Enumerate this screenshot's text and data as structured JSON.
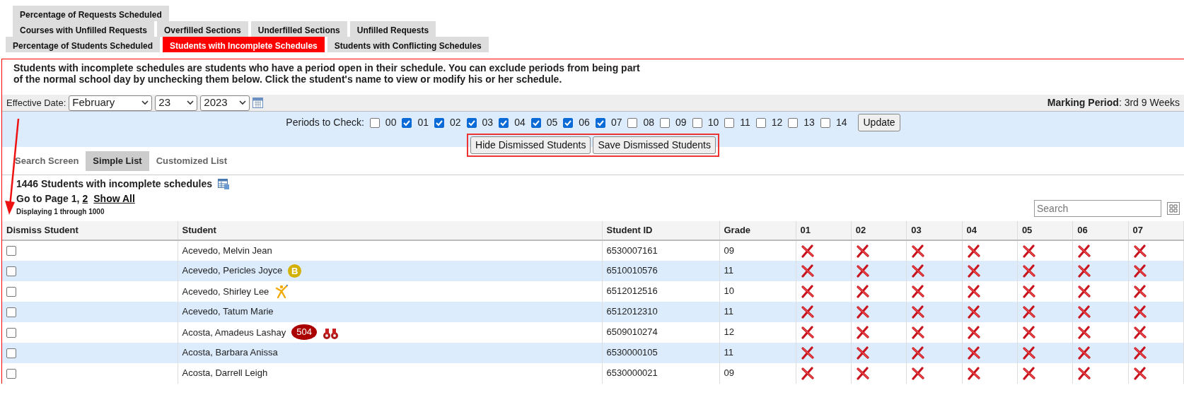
{
  "report_tab_rows": [
    [
      {
        "label": "Percentage of Requests Scheduled",
        "selected": false
      }
    ],
    [
      {
        "label": "Courses with Unfilled Requests",
        "selected": false
      },
      {
        "label": "Overfilled Sections",
        "selected": false
      },
      {
        "label": "Underfilled Sections",
        "selected": false
      },
      {
        "label": "Unfilled Requests",
        "selected": false
      }
    ],
    [
      {
        "label": "Percentage of Students Scheduled",
        "selected": false
      },
      {
        "label": "Students with Incomplete Schedules",
        "selected": true
      },
      {
        "label": "Students with Conflicting Schedules",
        "selected": false
      }
    ]
  ],
  "description": "Students with incomplete schedules are students who have a period open in their schedule. You can exclude periods from being part of the normal school day by unchecking them below. Click the student's name to view or modify his or her schedule.",
  "effective_date": {
    "label": "Effective Date:",
    "month": "February",
    "day": "23",
    "year": "2023"
  },
  "marking_period": {
    "label": "Marking Period",
    "value": ": 3rd 9 Weeks"
  },
  "periods_to_check": {
    "label": "Periods to Check:",
    "periods": [
      {
        "label": "00",
        "checked": false
      },
      {
        "label": "01",
        "checked": true
      },
      {
        "label": "02",
        "checked": true
      },
      {
        "label": "03",
        "checked": true
      },
      {
        "label": "04",
        "checked": true
      },
      {
        "label": "05",
        "checked": true
      },
      {
        "label": "06",
        "checked": true
      },
      {
        "label": "07",
        "checked": true
      },
      {
        "label": "08",
        "checked": false
      },
      {
        "label": "09",
        "checked": false
      },
      {
        "label": "10",
        "checked": false
      },
      {
        "label": "11",
        "checked": false
      },
      {
        "label": "12",
        "checked": false
      },
      {
        "label": "13",
        "checked": false
      },
      {
        "label": "14",
        "checked": false
      }
    ],
    "update_button": "Update"
  },
  "action_buttons": [
    "Hide Dismissed Students",
    "Save Dismissed Students"
  ],
  "list_tabs": [
    {
      "label": "Search Screen",
      "selected": false
    },
    {
      "label": "Simple List",
      "selected": true
    },
    {
      "label": "Customized List",
      "selected": false
    }
  ],
  "result_count": "1446 Students with incomplete schedules",
  "pagination": {
    "label": "Go to Page",
    "current": "1,",
    "pages": [
      "2"
    ],
    "show_all": "Show All"
  },
  "displaying": "Displaying 1 through 1000",
  "search": {
    "placeholder": "Search"
  },
  "table": {
    "columns": [
      "Dismiss Student",
      "Student",
      "Student ID",
      "Grade",
      "01",
      "02",
      "03",
      "04",
      "05",
      "06",
      "07"
    ],
    "rows": [
      {
        "dismiss": false,
        "student": "Acevedo, Melvin Jean",
        "badges": [],
        "student_id": "6530007161",
        "grade": "09",
        "open_periods": [
          true,
          true,
          true,
          true,
          true,
          true,
          true
        ]
      },
      {
        "dismiss": false,
        "student": "Acevedo, Pericles Joyce",
        "badges": [
          {
            "kind": "coin",
            "text": "B"
          }
        ],
        "student_id": "6510010576",
        "grade": "11",
        "open_periods": [
          true,
          true,
          true,
          true,
          true,
          true,
          true
        ]
      },
      {
        "dismiss": false,
        "student": "Acevedo, Shirley Lee",
        "badges": [
          {
            "kind": "figure"
          }
        ],
        "student_id": "6512012516",
        "grade": "10",
        "open_periods": [
          true,
          true,
          true,
          true,
          true,
          true,
          true
        ]
      },
      {
        "dismiss": false,
        "student": "Acevedo, Tatum Marie",
        "badges": [],
        "student_id": "6512012310",
        "grade": "11",
        "open_periods": [
          true,
          true,
          true,
          true,
          true,
          true,
          true
        ]
      },
      {
        "dismiss": false,
        "student": "Acosta, Amadeus Lashay",
        "badges": [
          {
            "kind": "pill",
            "text": "504"
          },
          {
            "kind": "binoculars"
          }
        ],
        "student_id": "6509010274",
        "grade": "12",
        "open_periods": [
          true,
          true,
          true,
          true,
          true,
          true,
          true
        ]
      },
      {
        "dismiss": false,
        "student": "Acosta, Barbara Anissa",
        "badges": [],
        "student_id": "6530000105",
        "grade": "11",
        "open_periods": [
          true,
          true,
          true,
          true,
          true,
          true,
          true
        ]
      },
      {
        "dismiss": false,
        "student": "Acosta, Darrell Leigh",
        "badges": [],
        "student_id": "6530000021",
        "grade": "09",
        "open_periods": [
          true,
          true,
          true,
          true,
          true,
          true,
          true
        ]
      }
    ]
  }
}
